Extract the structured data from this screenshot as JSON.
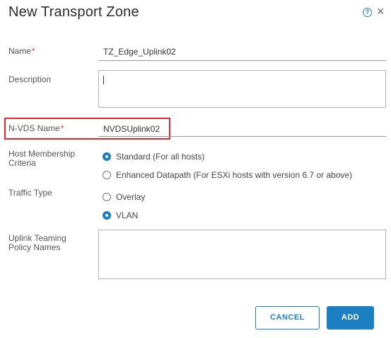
{
  "dialog": {
    "title": "New Transport Zone",
    "help_icon_glyph": "?",
    "close_icon_glyph": "×"
  },
  "form": {
    "name": {
      "label": "Name",
      "required_mark": "*",
      "value": "TZ_Edge_Uplink02"
    },
    "description": {
      "label": "Description",
      "value": ""
    },
    "nvds_name": {
      "label": "N-VDS Name",
      "required_mark": "*",
      "value": "NVDSUplink02"
    },
    "host_membership": {
      "label_line1": "Host Membership",
      "label_line2": "Criteria",
      "options": [
        {
          "label": "Standard (For all hosts)",
          "selected": true
        },
        {
          "label": "Enhanced Datapath (For ESXi hosts with version 6.7 or above)",
          "selected": false
        }
      ]
    },
    "traffic_type": {
      "label": "Traffic Type",
      "options": [
        {
          "label": "Overlay",
          "selected": false
        },
        {
          "label": "VLAN",
          "selected": true
        }
      ]
    },
    "uplink_teaming": {
      "label_line1": "Uplink Teaming",
      "label_line2": "Policy Names",
      "value": ""
    }
  },
  "buttons": {
    "cancel": "CANCEL",
    "add": "ADD"
  },
  "colors": {
    "accent": "#1b7fc1",
    "required": "#d93a3a",
    "highlight": "#e0272e"
  }
}
